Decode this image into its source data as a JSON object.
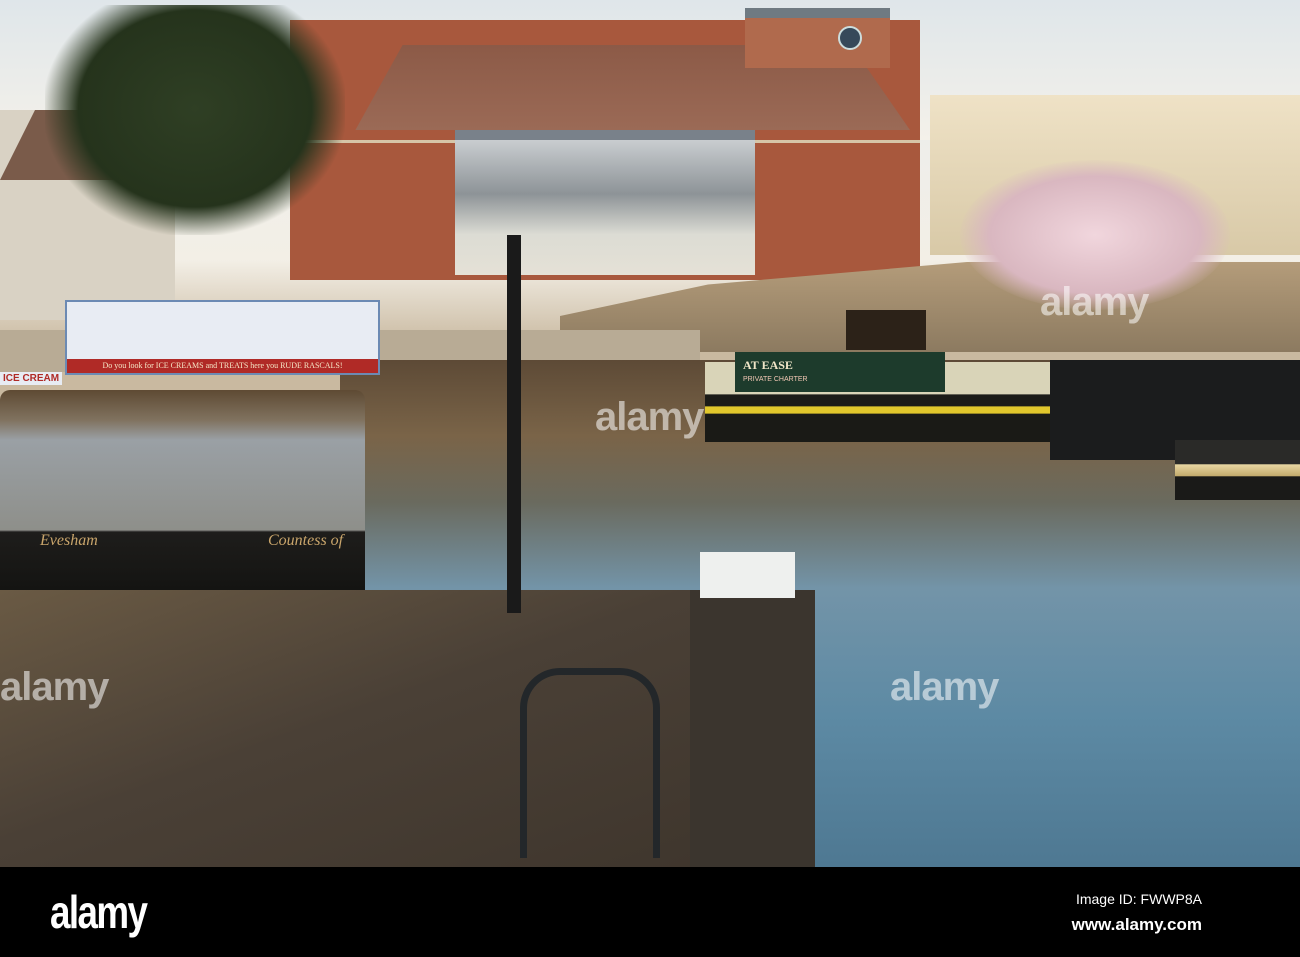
{
  "photo": {
    "boats": {
      "ice_cream_boat_slogan": "Do you look for ICE CREAMS and TREATS here you RUDE RASCALS!",
      "ice_cream_sign": "ICE CREAM",
      "left_boat_name_1": "Evesham",
      "left_boat_name_2": "Countess of",
      "narrowboat_name": "AT EASE",
      "narrowboat_sub": "PRIVATE CHARTER"
    },
    "watermark": "alamy"
  },
  "footer": {
    "logo": "alamy",
    "image_id": "Image ID: FWWP8A",
    "url": "www.alamy.com"
  }
}
